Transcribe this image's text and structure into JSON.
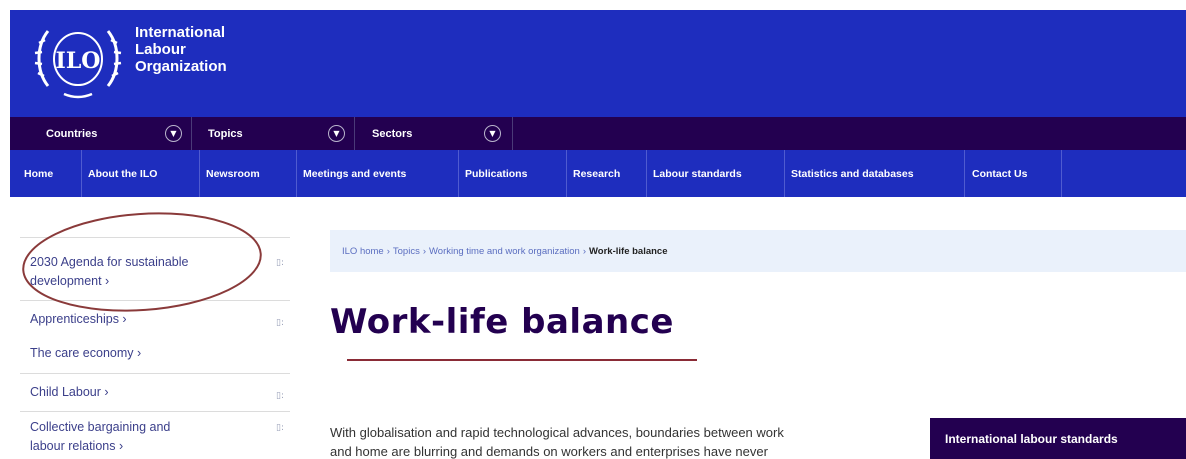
{
  "header": {
    "logo_text": "ILO",
    "org_name_lines": [
      "International",
      "Labour",
      "Organization"
    ],
    "bg_color": "#1e2dbe"
  },
  "utility_nav": {
    "items": [
      {
        "label": "Countries",
        "icon": "chevron-down-icon"
      },
      {
        "label": "Topics",
        "icon": "chevron-down-icon"
      },
      {
        "label": "Sectors",
        "icon": "chevron-down-icon"
      }
    ],
    "bg_color": "#230050"
  },
  "main_nav": {
    "items": [
      "Home",
      "About the ILO",
      "Newsroom",
      "Meetings and events",
      "Publications",
      "Research",
      "Labour standards",
      "Statistics and databases",
      "Contact Us"
    ]
  },
  "sidebar": {
    "items": [
      {
        "label_lines": [
          "2030 Agenda for sustainable",
          "development ›"
        ],
        "icon": "pdf-icon",
        "icon_text": "▯:"
      },
      {
        "label_lines": [
          "Apprenticeships ›"
        ],
        "icon": "pdf-icon",
        "icon_text": "▯:"
      },
      {
        "label_lines": [
          "The care economy ›"
        ],
        "icon": "",
        "icon_text": ""
      },
      {
        "label_lines": [
          "Child Labour ›"
        ],
        "icon": "pdf-icon",
        "icon_text": "▯:"
      },
      {
        "label_lines": [
          "Collective bargaining and",
          "labour relations ›"
        ],
        "icon": "pdf-icon",
        "icon_text": "▯:"
      }
    ]
  },
  "breadcrumb": {
    "items": [
      "ILO home",
      "Topics",
      "Working time and work organization"
    ],
    "current": "Work-life balance",
    "separator": "›"
  },
  "main": {
    "title": "Work-life balance",
    "intro_lines": [
      "With globalisation and rapid technological advances, boundaries between work",
      "and home are blurring and demands on workers and enterprises have never"
    ]
  },
  "side_box": {
    "label": "International labour standards"
  },
  "colors": {
    "brand_blue": "#1e2dbe",
    "brand_purple": "#230050",
    "accent_red": "#8a2b36",
    "annotation": "#8a3a3a"
  }
}
